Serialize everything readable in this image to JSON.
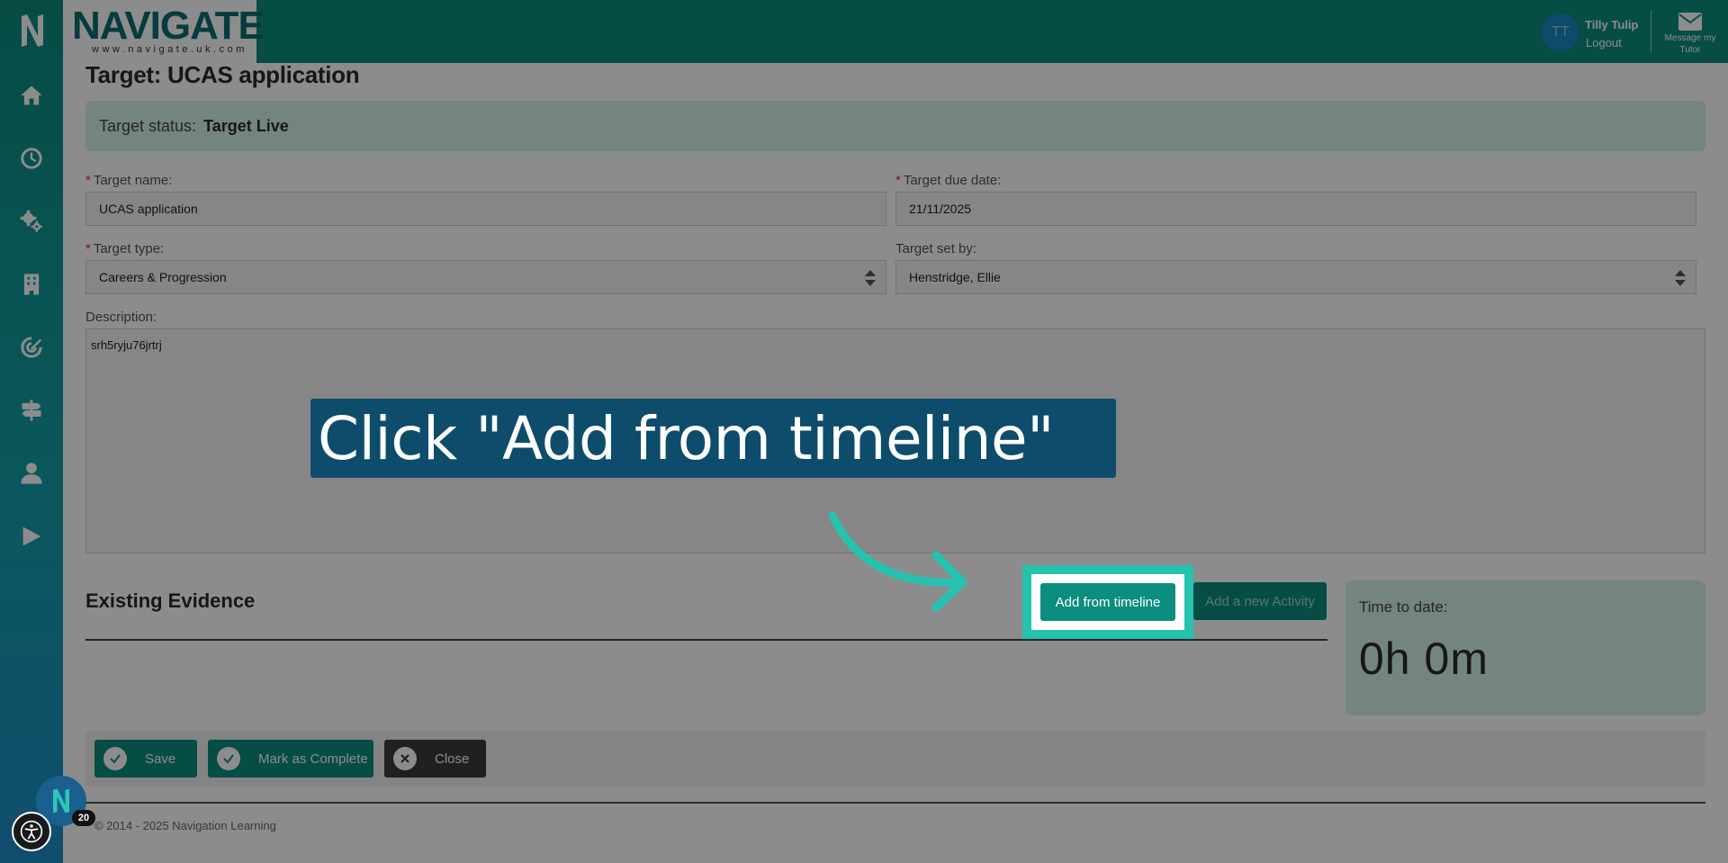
{
  "header": {
    "brand_word": "NAVIGATE",
    "brand_url": "www.navigate.uk.com",
    "user_initials": "TT",
    "user_name": "Tilly Tulip",
    "logout_label": "Logout",
    "message_label": "Message my Tutor"
  },
  "sidebar": {
    "items": [
      {
        "icon": "home-icon"
      },
      {
        "icon": "clock-icon"
      },
      {
        "icon": "gears-icon"
      },
      {
        "icon": "building-icon"
      },
      {
        "icon": "target-icon"
      },
      {
        "icon": "signpost-icon"
      },
      {
        "icon": "user-icon"
      },
      {
        "icon": "play-icon"
      }
    ]
  },
  "page": {
    "title": "Target: UCAS application",
    "status_label": "Target status:",
    "status_value": "Target Live"
  },
  "form": {
    "name_label": "Target name:",
    "name_value": "UCAS application",
    "due_label": "Target due date:",
    "due_value": "21/11/2025",
    "type_label": "Target type:",
    "type_value": "Careers & Progression",
    "setby_label": "Target set by:",
    "setby_value": "Henstridge, Ellie",
    "description_label": "Description:",
    "description_value": "srh5ryju76jrtrj"
  },
  "evidence": {
    "title": "Existing Evidence",
    "add_from_timeline": "Add from timeline",
    "add_activity": "Add a new Activity",
    "time_label": "Time to date:",
    "time_value": "0h 0m"
  },
  "actions": {
    "save": "Save",
    "complete": "Mark as Complete",
    "close": "Close"
  },
  "footer": {
    "copyright": "© 2014 - 2025 Navigation Learning"
  },
  "overlay": {
    "callout_text": "Click \"Add from timeline\"",
    "badge_count": "20"
  },
  "colors": {
    "brand_teal": "#0b8d7f",
    "highlight": "#26c2b0",
    "callout_bg": "#0d4c6b",
    "close_btn": "#3b3b3b"
  }
}
